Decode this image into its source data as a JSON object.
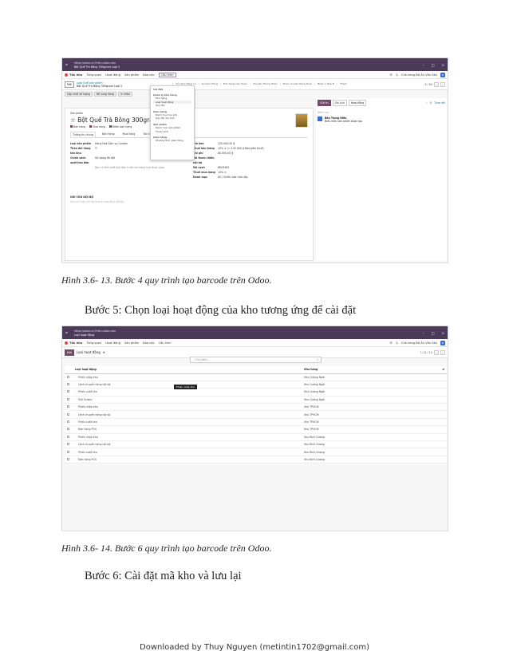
{
  "shot1": {
    "window_title": "Odoo",
    "url_line1": "https://odoo.vn/?db=odoo.com",
    "url_line2": "Bột Quế Trà Bông 300gram  Loại 2",
    "menu": [
      "Tồn kho",
      "Tổng quan",
      "Hoạt động",
      "Sản phẩm",
      "Báo cáo",
      "Cấu hình"
    ],
    "company": "Cửa hàng Đồ Ăn Văn Sân",
    "new_btn": "Mới",
    "breadcrumb_top": "Loại Quế sản phẩm",
    "breadcrumb_bottom": "Bột Quế Trà Bông 300gram Loại 2",
    "smart_buttons": [
      "Tồn kho Hàng có",
      "Sự kiện Trống",
      "Đơn hàng Cần Hoàn",
      "Chuyển Thông Hoàn",
      "Được ra Giao Hàng thuê",
      "Phiếu 1 Hóa Đ",
      "Thêm"
    ],
    "pager": "4 / 60",
    "status_buttons": [
      "Cập nhật số lượng",
      "Bổ sung hàng",
      "In nhãn"
    ],
    "product_label": "Sản phẩm",
    "product_title": "Bột Quế Trà Bông 300gra",
    "checkboxes": [
      "Bán hàng",
      "Mua hàng",
      "Điểm bán hàng"
    ],
    "form_tabs": [
      "Thông tin chung",
      "Bán Hàng",
      "Mua hàng",
      "Tồn kho"
    ],
    "left_fields": [
      {
        "label": "Loại sản phẩm",
        "value": "Hàng hóa   Dịch vụ   Combo"
      },
      {
        "label": "Theo dõi hàng tồn kho",
        "value": "☑"
      },
      {
        "label": "Chính sách xuất hóa đơn",
        "value": "Số lượng đã đặt"
      },
      {
        "label": "",
        "value": "Bạn có thể xuất hóa đơn trước khi hàng hoá được giao."
      }
    ],
    "right_fields": [
      {
        "label": "Giá bán",
        "value": "120.000,00 ₫"
      },
      {
        "label": "Thuế bán hàng",
        "value": "10% ×     (= 132.000 ₫ Bao gồm thuế)"
      },
      {
        "label": "Chi phí",
        "value": "80.000,00 ₫"
      },
      {
        "label": "Mã tham chiếu nội bộ",
        "value": ""
      },
      {
        "label": "Mã vạch",
        "value": "8629363"
      },
      {
        "label": "Thuế mua hàng",
        "value": "10% ×"
      },
      {
        "label": "Danh mục",
        "value": "All / Chiến lược nhà cấp"
      }
    ],
    "notes_label": "GHI CHÚ NỘI BỘ",
    "notes_placeholder": "Ghi chú này chỉ dành cho mục đích nội bộ",
    "dropdown": {
      "sections": [
        {
          "head": "Cài đặt",
          "items": []
        },
        {
          "head": "Quản lý kho hàng",
          "items": [
            "Kho hàng",
            "Loại hoạt động",
            "Quy tắc"
          ]
        },
        {
          "head": "Giao hàng",
          "items": [
            "Danh mục lưu kho",
            "Quy tắc lưu kho"
          ]
        },
        {
          "head": "Sản phẩm",
          "items": [
            "Danh mục sản phẩm",
            "Thuộc tính"
          ]
        },
        {
          "head": "Giao hàng",
          "items": [
            "Phương thức giao hàng"
          ]
        }
      ]
    },
    "chatter_tabs": [
      "Gửi tin",
      "Ghi chú",
      "Hoạt động"
    ],
    "chatter_follow": "Theo dõi",
    "chatter_date": "Hôm nay",
    "chatter_author": "Bảo Trung Hiếu",
    "chatter_msg": "Biểu mẫu sản phẩm được tạo"
  },
  "caption1": "Hình 3.6- 13. Bước 4 quy trình tạo barcode trên Odoo.",
  "step5": "Bước 5: Chọn loại hoạt động của kho tương ứng để cài đặt",
  "shot2": {
    "window_title": "Odoo",
    "url_line1": "https://odoo.vn/?db=odoo.com",
    "url_line2": "Loại hoạt động",
    "menu": [
      "Tồn kho",
      "Tổng quan",
      "Hoạt động",
      "Sản phẩm",
      "Báo cáo",
      "Cấu hình"
    ],
    "company": "Cửa hàng Đồ Ăn Văn Sân",
    "new_btn": "Mới",
    "page_title": "Loại hoạt động",
    "search_placeholder": "Tìm kiếm...",
    "pager": "1-12 / 12",
    "col_op": "Loại hoạt động",
    "col_wh": "Kho hàng",
    "tooltip": "Phiếu nhập kho",
    "rows": [
      {
        "op": "Phiếu nhập kho",
        "wh": "Kho Quảng Ngãi"
      },
      {
        "op": "Lệnh chuyển hàng nội bộ",
        "wh": "Kho Quảng Ngãi"
      },
      {
        "op": "Phiếu xuất kho",
        "wh": "Kho Quảng Ngãi"
      },
      {
        "op": "PoS Orders",
        "wh": "Kho Quảng Ngãi"
      },
      {
        "op": "Phiếu nhập kho",
        "wh": "Kho TPHCM"
      },
      {
        "op": "Lệnh chuyển hàng nội bộ",
        "wh": "Kho TPHCM"
      },
      {
        "op": "Phiếu xuất kho",
        "wh": "Kho TPHCM"
      },
      {
        "op": "Đơn hàng POS",
        "wh": "Kho TPHCM"
      },
      {
        "op": "Phiếu nhập kho",
        "wh": "Kho Bình Dương"
      },
      {
        "op": "Lệnh chuyển hàng nội bộ",
        "wh": "Kho Bình Dương"
      },
      {
        "op": "Phiếu xuất kho",
        "wh": "Kho Bình Dương"
      },
      {
        "op": "Đơn hàng POS",
        "wh": "Kho Bình Dương"
      }
    ]
  },
  "caption2": "Hình 3.6- 14. Bước 6 quy trình tạo barcode trên Odoo.",
  "step6": "Bước 6: Cài đặt mã kho và lưu lại",
  "footer": "Downloaded by Thuy Nguyen (metintin1702@gmail.com)"
}
